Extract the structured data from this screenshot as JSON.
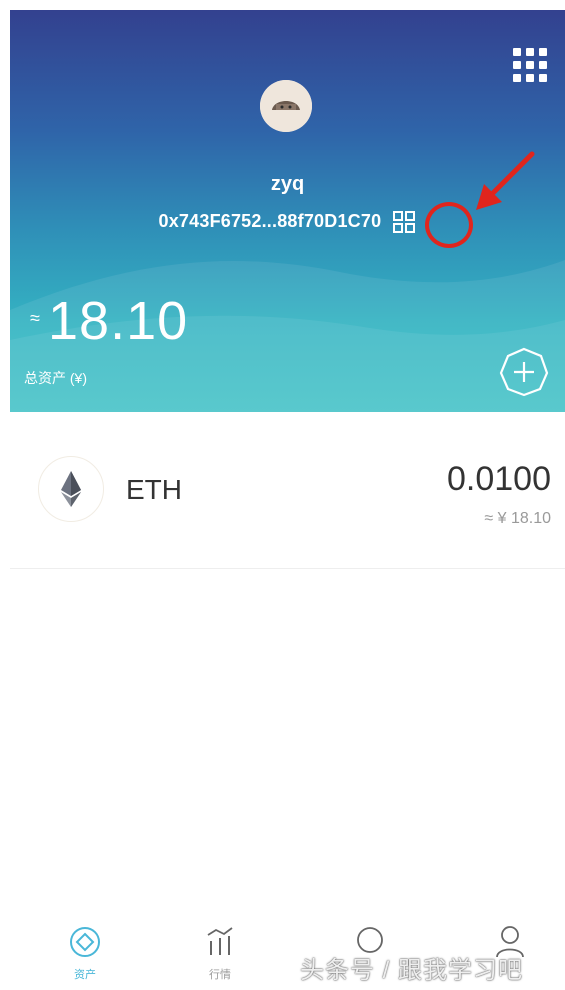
{
  "header": {
    "username": "zyq",
    "address": "0x743F6752...88f70D1C70",
    "approx_symbol": "≈",
    "balance": "18.10",
    "balance_label": "总资产 (¥)"
  },
  "assets": [
    {
      "symbol": "ETH",
      "amount": "0.0100",
      "fiat": "≈ ¥ 18.10"
    }
  ],
  "tabbar": {
    "items": [
      {
        "label": "资产",
        "icon": "assets-icon",
        "active": true
      },
      {
        "label": "行情",
        "icon": "market-icon",
        "active": false
      },
      {
        "label": "",
        "icon": "discover-icon",
        "active": false
      },
      {
        "label": "",
        "icon": "profile-icon",
        "active": false
      }
    ]
  },
  "watermark": "头条号 / 跟我学习吧",
  "colors": {
    "header_top": "#33418f",
    "header_bottom": "#3ec0c6",
    "annotation_red": "#e0251d",
    "tab_active": "#4ab7d8"
  }
}
